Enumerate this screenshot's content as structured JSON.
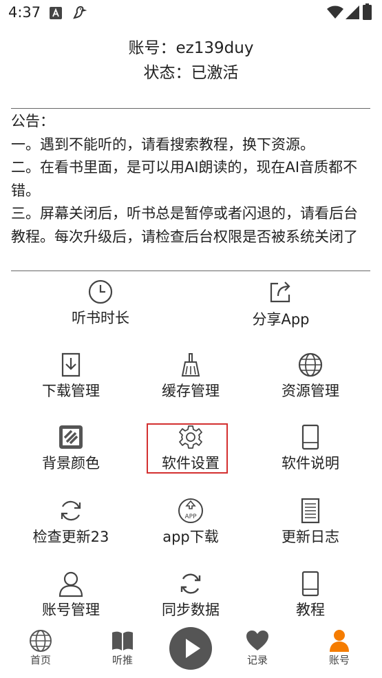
{
  "status_bar": {
    "time": "4:37"
  },
  "account": {
    "id_line": "账号：ez139duy",
    "status_line": "状态：已激活"
  },
  "notice": {
    "text": "公告：\n一。遇到不能听的，请看搜索教程，换下资源。\n二。在看书里面，是可以用AI朗读的，现在AI音质都不错。\n三。屏幕关闭后，听书总是暂停或者闪退的，请看后台教程。每次升级后，请检查后台权限是否被系统关闭了"
  },
  "grid": {
    "listen_time": "听书时长",
    "share_app": "分享App",
    "download_mgmt": "下载管理",
    "cache_mgmt": "缓存管理",
    "source_mgmt": "资源管理",
    "bg_color": "背景颜色",
    "app_settings": "软件设置",
    "app_manual": "软件说明",
    "check_update": "检查更新23",
    "app_download": "app下载",
    "changelog": "更新日志",
    "account_mgmt": "账号管理",
    "sync_data": "同步数据",
    "tutorial": "教程"
  },
  "bottom_nav": {
    "home": "首页",
    "listen_rec": "听推",
    "records": "记录",
    "account": "账号",
    "accent_color": "#f57c00"
  },
  "icons": {
    "app_download_badge": "APP"
  }
}
